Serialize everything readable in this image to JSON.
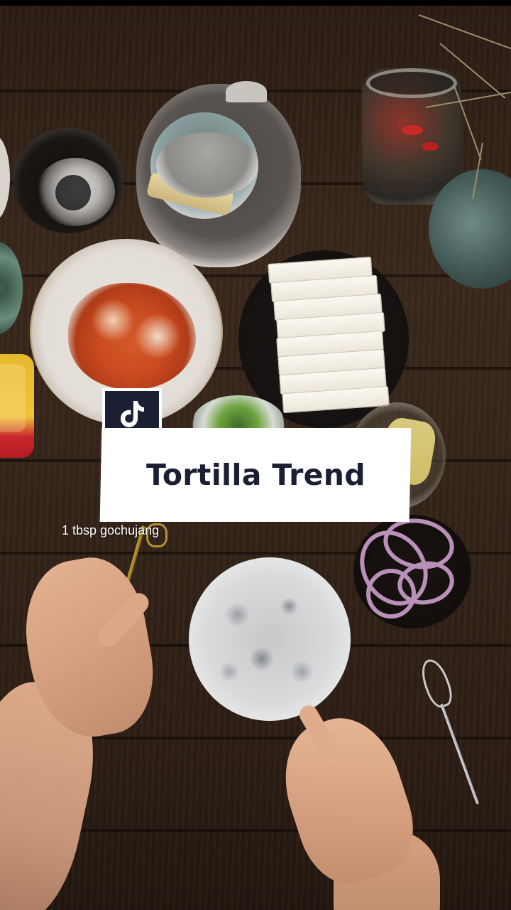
{
  "overlay": {
    "badge_icon": "tiktok-note-icon",
    "title": "Tortilla Trend",
    "caption": "1 tbsp gochujang"
  },
  "colors": {
    "title_card_bg": "#ffffff",
    "title_text": "#1b1f33",
    "badge_bg": "#1b1f33",
    "caption_text": "#ffffff"
  }
}
